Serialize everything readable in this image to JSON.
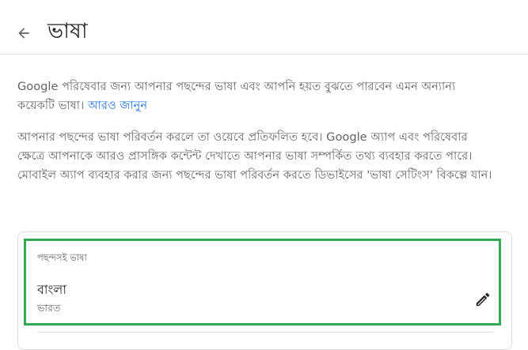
{
  "header": {
    "back_icon": "arrow-back-icon",
    "title": "ভাষা"
  },
  "intro": {
    "text": "Google পরিষেবার জন্য আপনার পছন্দের ভাষা এবং আপনি হয়ত বুঝতে পারবেন এমন অন্যান্য কয়েকটি ভাষা।",
    "learn_more": "আরও জানুন"
  },
  "details": {
    "text": "আপনার পছন্দের ভাষা পরিবর্তন করলে তা ওয়েবে প্রতিফলিত হবে। Google অ্যাপ এবং পরিষেবার ক্ষেত্রে আপনাকে আরও প্রাসঙ্গিক কন্টেন্ট দেখাতে আপনার ভাষা সম্পর্কিত তথ্য ব্যবহার করতে পারে। মোবাইল অ্যাপ ব্যবহার করার জন্য পছন্দের ভাষা পরিবর্তন করতে ডিভাইসের 'ভাষা সেটিংস' বিকল্পে যান।"
  },
  "preferred_language": {
    "label": "পছন্দসই ভাষা",
    "language": "বাংলা",
    "region": "ভারত",
    "edit_icon": "pencil-icon",
    "highlight_color": "#34a853"
  },
  "colors": {
    "link": "#1a73e8",
    "text_primary": "#202124",
    "text_secondary": "#5f6368"
  }
}
